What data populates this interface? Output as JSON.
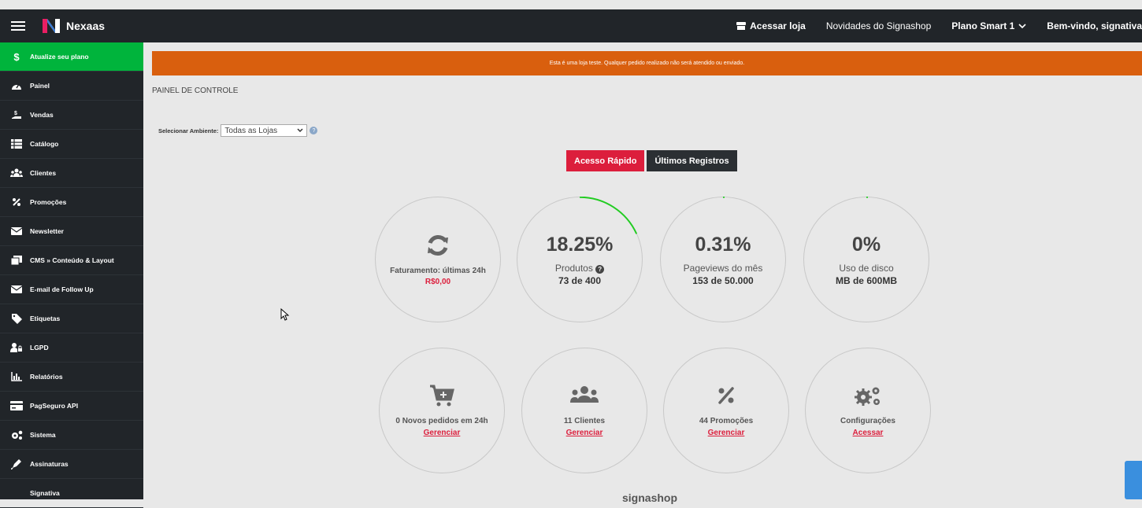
{
  "topbar": {
    "brand": "Nexaas",
    "store_link": "Acessar loja",
    "news": "Novidades do Signashop",
    "plan": "Plano Smart 1",
    "welcome": "Bem-vindo, signativa"
  },
  "sidebar": {
    "upgrade": "Atualize seu plano",
    "items": [
      {
        "label": "Painel",
        "icon": "dashboard-icon"
      },
      {
        "label": "Vendas",
        "icon": "sales-icon"
      },
      {
        "label": "Catálogo",
        "icon": "catalog-icon"
      },
      {
        "label": "Clientes",
        "icon": "users-icon"
      },
      {
        "label": "Promoções",
        "icon": "percent-icon"
      },
      {
        "label": "Newsletter",
        "icon": "envelope-icon"
      },
      {
        "label": "CMS » Conteúdo & Layout",
        "icon": "cms-icon"
      },
      {
        "label": "E-mail de Follow Up",
        "icon": "envelope-icon"
      },
      {
        "label": "Etiquetas",
        "icon": "tag-icon"
      },
      {
        "label": "LGPD",
        "icon": "user-lock-icon"
      },
      {
        "label": "Relatórios",
        "icon": "chart-icon"
      },
      {
        "label": "PagSeguro API",
        "icon": "card-icon"
      },
      {
        "label": "Sistema",
        "icon": "gears-icon"
      },
      {
        "label": "Assinaturas",
        "icon": "pen-icon"
      },
      {
        "label": "Signativa",
        "icon": ""
      }
    ]
  },
  "main": {
    "alert": "Esta é uma loja teste. Qualquer pedido realizado não será atendido ou enviado.",
    "title": "PAINEL DE CONTROLE",
    "env_label": "Selecionar Ambiente:",
    "env_value": "Todas as Lojas",
    "tab_quick": "Acesso Rápido",
    "tab_logs": "Últimos Registros",
    "revenue_label": "Faturamento: últimas 24h",
    "revenue_value": "R$0,00",
    "products_pct": "18.25%",
    "products_label": "Produtos",
    "products_sub": "73 de 400",
    "pageviews_pct": "0.31%",
    "pageviews_label": "Pageviews do mês",
    "pageviews_sub": "153 de 50.000",
    "disk_pct": "0%",
    "disk_label": "Uso de disco",
    "disk_sub": "MB de 600MB",
    "orders_label": "0 Novos pedidos em 24h",
    "orders_link": "Gerenciar",
    "clients_label": "11 Clientes",
    "clients_link": "Gerenciar",
    "promos_label": "44 Promoções",
    "promos_link": "Gerenciar",
    "config_label": "Configurações",
    "config_link": "Acessar",
    "footer_brand": "signashop"
  },
  "colors": {
    "accent": "#dc1e3c",
    "sidebar": "#212529",
    "upgrade": "#00b43c",
    "alert": "#d95f0e",
    "progress": "#22cc22"
  }
}
